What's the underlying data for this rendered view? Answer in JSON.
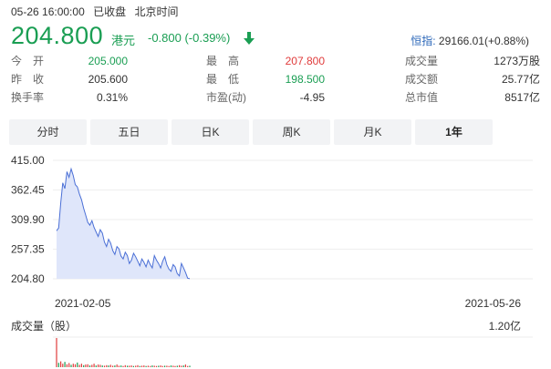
{
  "status": {
    "datetime": "05-26 16:00:00",
    "market_state": "已收盘",
    "timezone": "北京时间"
  },
  "quote": {
    "price": "204.800",
    "currency": "港元",
    "change": "-0.800 (-0.39%)",
    "trend_icon": "down-arrow-icon",
    "color_down": "#1a9e53",
    "color_up": "#e03b3b"
  },
  "index": {
    "name": "恒指:",
    "value": "29166.01(+0.88%)"
  },
  "stats": {
    "open_label": "今　开",
    "open": "205.000",
    "prev_close_label": "昨　收",
    "prev_close": "205.600",
    "turnover_rate_label": "换手率",
    "turnover_rate": "0.31%",
    "high_label": "最　高",
    "high": "207.800",
    "low_label": "最　低",
    "low": "198.500",
    "pe_label": "市盈(动)",
    "pe": "-4.95",
    "volume_label": "成交量",
    "volume": "1273万股",
    "amount_label": "成交额",
    "amount": "25.77亿",
    "market_cap_label": "总市值",
    "market_cap": "8517亿"
  },
  "tabs": [
    {
      "label": "分时",
      "active": false
    },
    {
      "label": "五日",
      "active": false
    },
    {
      "label": "日K",
      "active": false
    },
    {
      "label": "周K",
      "active": false
    },
    {
      "label": "月K",
      "active": false
    },
    {
      "label": "1年",
      "active": true
    }
  ],
  "chart_data": {
    "type": "area",
    "y_ticks": [
      "415.00",
      "362.45",
      "309.90",
      "257.35",
      "204.80"
    ],
    "ylim": [
      204.8,
      415.0
    ],
    "x_start_label": "2021-02-05",
    "x_end_label": "2021-05-26",
    "line_color": "#4a6fd6",
    "fill_color": "#dfe6fa",
    "price_series": [
      290,
      295,
      340,
      375,
      365,
      395,
      385,
      400,
      388,
      372,
      368,
      355,
      345,
      330,
      318,
      305,
      300,
      308,
      296,
      288,
      280,
      292,
      286,
      270,
      262,
      275,
      268,
      255,
      248,
      262,
      258,
      245,
      240,
      252,
      246,
      232,
      238,
      250,
      244,
      236,
      228,
      240,
      234,
      226,
      238,
      230,
      224,
      246,
      238,
      232,
      224,
      236,
      244,
      230,
      222,
      218,
      230,
      226,
      214,
      210,
      232,
      224,
      216,
      206,
      205
    ],
    "volume_label": "成交量（股）",
    "volume_max_label": "1.20亿",
    "volume_series": [
      1.0,
      0.15,
      0.2,
      0.12,
      0.18,
      0.1,
      0.14,
      0.08,
      0.12,
      0.1,
      0.16,
      0.08,
      0.12,
      0.07,
      0.09,
      0.1,
      0.06,
      0.08,
      0.12,
      0.06,
      0.09,
      0.08,
      0.06,
      0.05,
      0.07,
      0.06,
      0.08,
      0.05,
      0.06,
      0.09,
      0.05,
      0.06,
      0.04,
      0.07,
      0.05,
      0.05,
      0.06,
      0.04,
      0.05,
      0.07,
      0.04,
      0.05,
      0.06,
      0.04,
      0.05,
      0.04,
      0.06,
      0.05,
      0.04,
      0.05,
      0.06,
      0.04,
      0.05,
      0.05,
      0.04,
      0.06,
      0.05,
      0.04,
      0.05,
      0.07,
      0.05,
      0.06,
      0.09,
      0.04,
      0.05
    ],
    "volume_up_color": "#e03b3b",
    "volume_down_color": "#1a9e53"
  }
}
